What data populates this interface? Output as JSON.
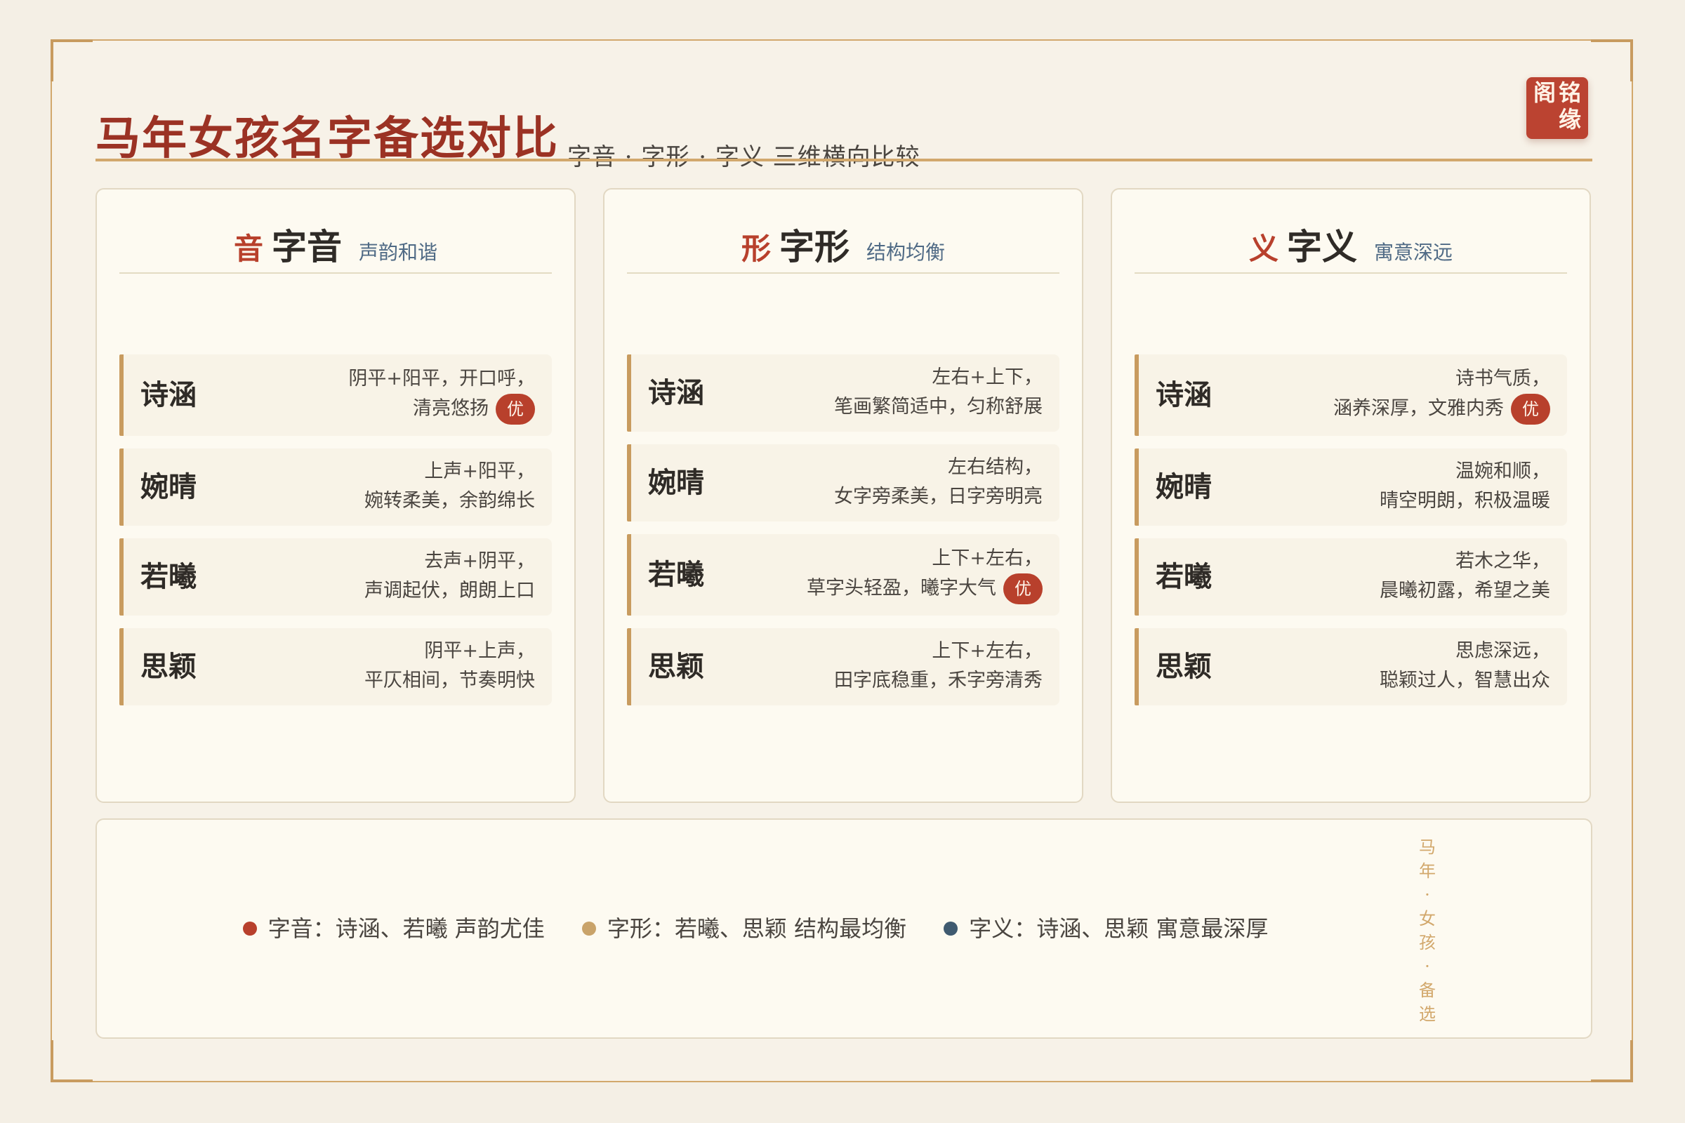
{
  "header": {
    "title": "马年女孩名字备选对比",
    "subtitle": "字音 · 字形 · 字义 三维横向比较",
    "seal": [
      "铭",
      "缘",
      "阁"
    ]
  },
  "colors": {
    "primary_red": "#b8402c",
    "gold": "#c89b5f",
    "blue": "#3f5a70",
    "background": "#f4efe5"
  },
  "panels": [
    {
      "char": "音",
      "name": "字音",
      "note": "声韵和谐",
      "rows": [
        {
          "name": "诗涵",
          "line1": "阴平+阳平，开口呼，",
          "line2": "清亮悠扬",
          "badge": "优"
        },
        {
          "name": "婉晴",
          "line1": "上声+阳平，",
          "line2": "婉转柔美，余韵绵长",
          "badge": ""
        },
        {
          "name": "若曦",
          "line1": "去声+阴平，",
          "line2": "声调起伏，朗朗上口",
          "badge": ""
        },
        {
          "name": "思颖",
          "line1": "阴平+上声，",
          "line2": "平仄相间，节奏明快",
          "badge": ""
        }
      ]
    },
    {
      "char": "形",
      "name": "字形",
      "note": "结构均衡",
      "rows": [
        {
          "name": "诗涵",
          "line1": "左右+上下，",
          "line2": "笔画繁简适中，匀称舒展",
          "badge": ""
        },
        {
          "name": "婉晴",
          "line1": "左右结构，",
          "line2": "女字旁柔美，日字旁明亮",
          "badge": ""
        },
        {
          "name": "若曦",
          "line1": "上下+左右，",
          "line2": "草字头轻盈，曦字大气",
          "badge": "优"
        },
        {
          "name": "思颖",
          "line1": "上下+左右，",
          "line2": "田字底稳重，禾字旁清秀",
          "badge": ""
        }
      ]
    },
    {
      "char": "义",
      "name": "字义",
      "note": "寓意深远",
      "rows": [
        {
          "name": "诗涵",
          "line1": "诗书气质，",
          "line2": "涵养深厚，文雅内秀",
          "badge": "优"
        },
        {
          "name": "婉晴",
          "line1": "温婉和顺，",
          "line2": "晴空明朗，积极温暖",
          "badge": ""
        },
        {
          "name": "若曦",
          "line1": "若木之华，",
          "line2": "晨曦初露，希望之美",
          "badge": ""
        },
        {
          "name": "思颖",
          "line1": "思虑深远，",
          "line2": "聪颖过人，智慧出众",
          "badge": ""
        }
      ]
    }
  ],
  "summary": [
    {
      "color": "#b8402c",
      "text": "字音：诗涵、若曦 声韵尤佳"
    },
    {
      "color": "#c9a36a",
      "text": "字形：若曦、思颖 结构最均衡"
    },
    {
      "color": "#3f5a70",
      "text": "字义：诗涵、思颖 寓意最深厚"
    }
  ],
  "vertical_note": [
    "马",
    "年",
    "·",
    "女",
    "孩",
    "·",
    "备",
    "选"
  ]
}
